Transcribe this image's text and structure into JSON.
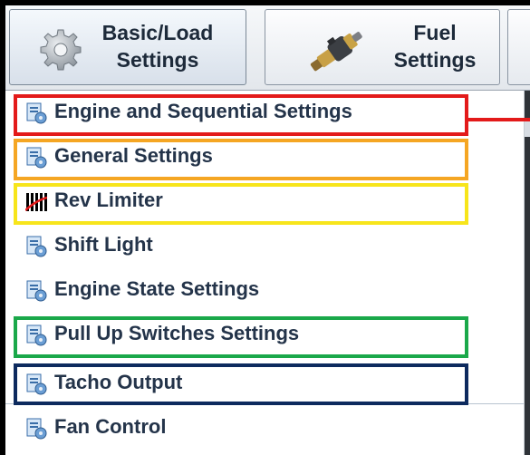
{
  "toolbar": {
    "basic": {
      "line1": "Basic/Load",
      "line2": "Settings",
      "icon": "gear-icon"
    },
    "fuel": {
      "line1": "Fuel",
      "line2": "Settings",
      "icon": "fuel-injector-icon"
    }
  },
  "menu": {
    "items": [
      {
        "label": "Engine and Sequential Settings",
        "icon": "settings-page-icon"
      },
      {
        "label": "General Settings",
        "icon": "settings-page-icon"
      },
      {
        "label": "Rev Limiter",
        "icon": "rev-limiter-icon"
      },
      {
        "label": "Shift Light",
        "icon": "settings-page-icon"
      },
      {
        "label": "Engine State Settings",
        "icon": "settings-page-icon"
      },
      {
        "label": "Pull Up Switches Settings",
        "icon": "settings-page-icon"
      },
      {
        "label": "Tacho Output",
        "icon": "settings-page-icon"
      },
      {
        "label": "Fan Control",
        "icon": "settings-page-icon"
      }
    ]
  },
  "highlights": {
    "red": "#e31a1a",
    "orange": "#f5a623",
    "yellow": "#f7e51b",
    "green": "#1aa84a",
    "navy": "#0d2a5e"
  }
}
